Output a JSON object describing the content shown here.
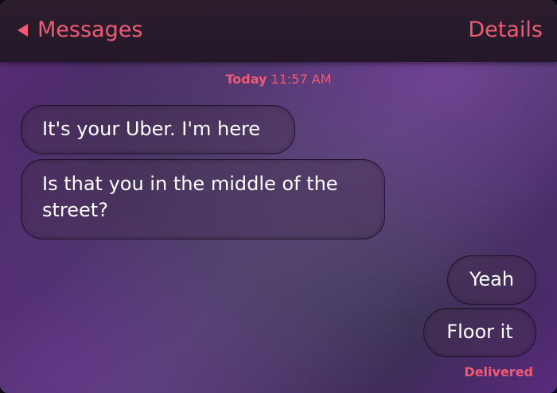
{
  "nav": {
    "back_label": "Messages",
    "details_label": "Details"
  },
  "thread": {
    "timestamp_day": "Today",
    "timestamp_time": "11:57 AM",
    "messages": [
      {
        "direction": "incoming",
        "text": "It's your Uber. I'm here"
      },
      {
        "direction": "incoming",
        "text": "Is that you in the middle of the street?"
      },
      {
        "direction": "outgoing",
        "text": "Yeah"
      },
      {
        "direction": "outgoing",
        "text": "Floor it"
      }
    ],
    "delivery_status": "Delivered"
  },
  "colors": {
    "accent": "#f05a73",
    "nav_background": "#2c1d2c",
    "bubble_text": "#ffffff"
  }
}
